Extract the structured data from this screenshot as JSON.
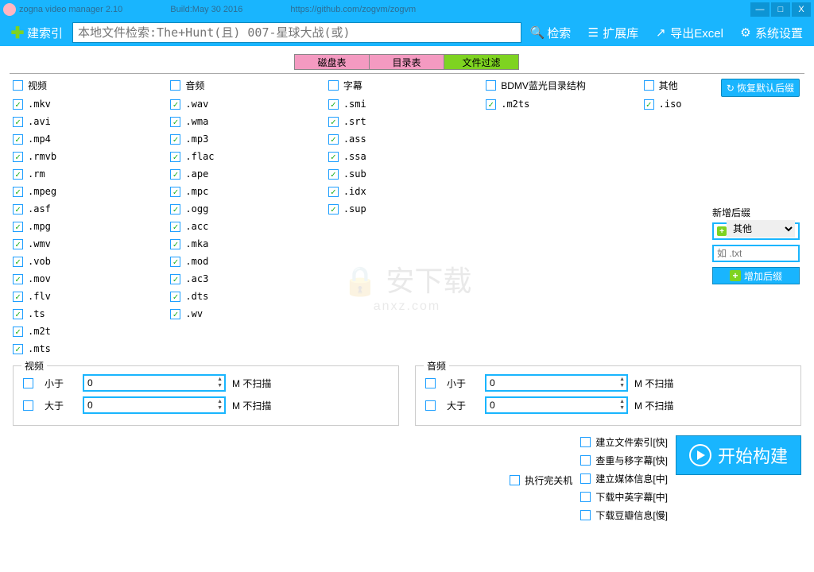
{
  "titlebar": {
    "app": "zogna video manager 2.10",
    "build": "Build:May 30 2016",
    "url": "https://github.com/zogvm/zogvm"
  },
  "toolbar": {
    "build_index": "建索引",
    "search_placeholder": "本地文件检索:The+Hunt(且) 007-星球大战(或)",
    "search": "检索",
    "extlib": "扩展库",
    "export": "导出Excel",
    "settings": "系统设置"
  },
  "tabs": {
    "disk": "磁盘表",
    "dir": "目录表",
    "filter": "文件过滤"
  },
  "headers": {
    "video": "视频",
    "audio": "音频",
    "subtitle": "字幕",
    "bdmv": "BDMV蓝光目录结构",
    "other": "其他"
  },
  "exts": {
    "video": [
      ".mkv",
      ".avi",
      ".mp4",
      ".rmvb",
      ".rm",
      ".mpeg",
      ".asf",
      ".mpg",
      ".wmv",
      ".vob",
      ".mov",
      ".flv",
      ".ts",
      ".m2t",
      ".mts"
    ],
    "audio": [
      ".wav",
      ".wma",
      ".mp3",
      ".flac",
      ".ape",
      ".mpc",
      ".ogg",
      ".acc",
      ".mka",
      ".mod",
      ".ac3",
      ".dts",
      ".wv"
    ],
    "subtitle": [
      ".smi",
      ".srt",
      ".ass",
      ".ssa",
      ".sub",
      ".idx",
      ".sup"
    ],
    "bdmv": [
      ".m2ts"
    ],
    "other": [
      ".iso"
    ]
  },
  "restore": "恢复默认后缀",
  "addpanel": {
    "title": "新增后缀",
    "category": "其他",
    "placeholder": "如 .txt",
    "button": "增加后缀"
  },
  "scan": {
    "video": "视频",
    "audio": "音频",
    "lt": "小于",
    "gt": "大于",
    "val": "0",
    "unit": "M 不扫描"
  },
  "bottom": {
    "shutdown": "执行完关机",
    "opts": [
      "建立文件索引[快]",
      "查重与移字幕[快]",
      "建立媒体信息[中]",
      "下载中英字幕[中]",
      "下载豆瓣信息[慢]"
    ],
    "start": "开始构建"
  },
  "watermark": {
    "main": "🔒 安下载",
    "sub": "anxz.com"
  }
}
